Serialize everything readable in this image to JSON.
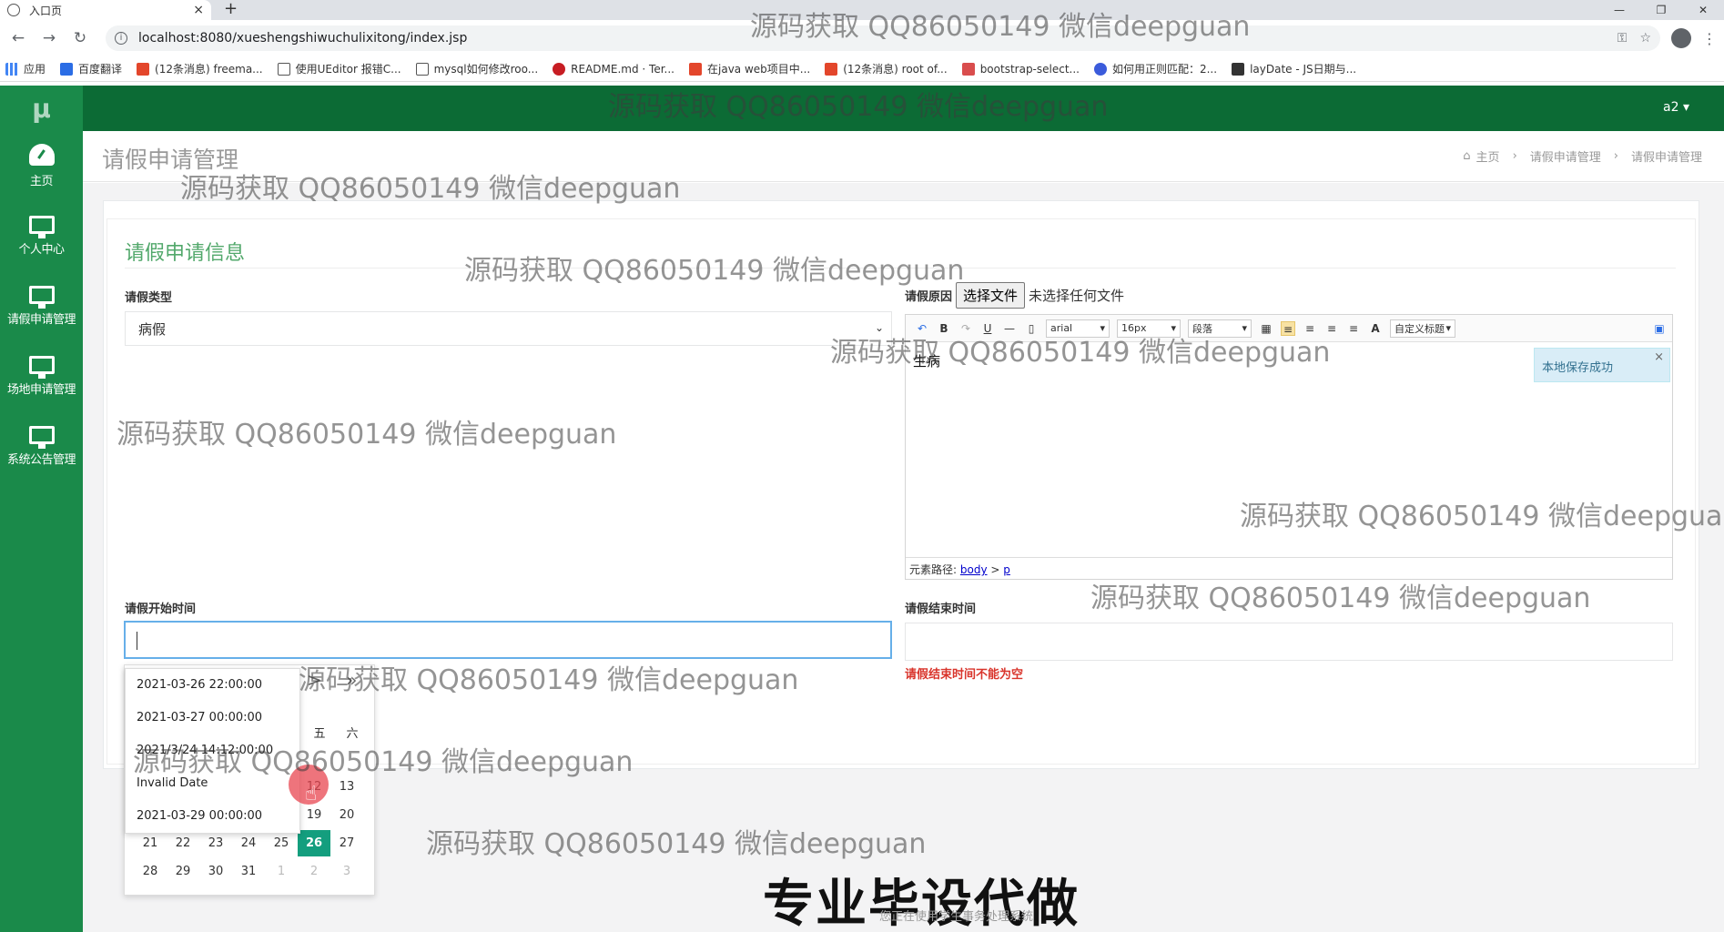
{
  "browser": {
    "tab_title": "入口页",
    "url": "localhost:8080/xueshengshiwuchulixitong/index.jsp",
    "bookmarks": [
      "应用",
      "百度翻译",
      "(12条消息) freema...",
      "使用UEditor 报错C...",
      "mysql如何修改roo...",
      "README.md · Ter...",
      "在java web项目中...",
      "(12条消息) root of...",
      "bootstrap-select...",
      "如何用正则匹配：2...",
      "layDate - JS日期与..."
    ]
  },
  "sidebar": {
    "logo": "μ",
    "items": [
      {
        "label": "主页",
        "icon": "dashboard-icon"
      },
      {
        "label": "个人中心",
        "icon": "monitor-icon"
      },
      {
        "label": "请假申请管理",
        "icon": "monitor-icon"
      },
      {
        "label": "场地申请管理",
        "icon": "monitor-icon"
      },
      {
        "label": "系统公告管理",
        "icon": "monitor-icon"
      }
    ]
  },
  "topbar": {
    "user": "a2 ▾"
  },
  "header": {
    "title": "请假申请管理",
    "breadcrumb": [
      "主页",
      "请假申请管理",
      "请假申请管理"
    ]
  },
  "form": {
    "section_title": "请假申请信息",
    "leave_type_label": "请假类型",
    "leave_type_value": "病假",
    "reason_label": "请假原因",
    "file_button": "选择文件",
    "file_status": "未选择任何文件",
    "editor": {
      "font": "arial",
      "size": "16px",
      "paragraph": "段落",
      "custom_title": "自定义标题",
      "content": "生病",
      "path_label": "元素路径:",
      "path_body": "body",
      "path_sep": ">",
      "path_p": "p",
      "toast": "本地保存成功"
    },
    "start_label": "请假开始时间",
    "start_value": "",
    "end_label": "请假结束时间",
    "end_value": "",
    "end_error": "请假结束时间不能为空"
  },
  "datepicker": {
    "suggestions": [
      "2021-03-26 22:00:00",
      "2021-03-27 00:00:00",
      "2021/3/24 14:12:00:00",
      "Invalid Date",
      "2021-03-29 00:00:00"
    ],
    "nav": "> »",
    "weekdays": [
      "五",
      "六"
    ],
    "rows": [
      [
        "",
        "",
        "",
        "",
        "",
        "12",
        "13"
      ],
      [
        "",
        "",
        "",
        "",
        "",
        "",
        "19",
        "20"
      ],
      [
        "21",
        "22",
        "23",
        "24",
        "25",
        "26",
        "27"
      ],
      [
        "28",
        "29",
        "30",
        "31",
        "1",
        "2",
        "3"
      ]
    ],
    "today": "26"
  },
  "watermarks": {
    "text": "源码获取 QQ86050149 微信deepguan",
    "banner": "专业毕设代做",
    "footer_faint": "您正在使用学生事务处理系统"
  }
}
